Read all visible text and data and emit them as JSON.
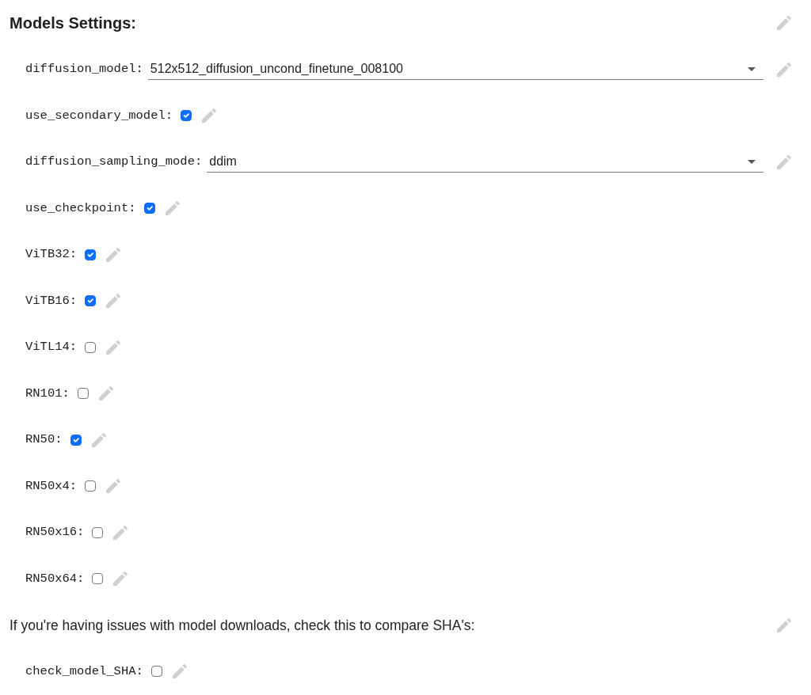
{
  "title": "Models Settings:",
  "fields": [
    {
      "kind": "dropdown",
      "label": "diffusion_model:",
      "value": "512x512_diffusion_uncond_finetune_008100"
    },
    {
      "kind": "checkbox",
      "label": "use_secondary_model:",
      "checked": true
    },
    {
      "kind": "dropdown",
      "label": "diffusion_sampling_mode:",
      "value": "ddim"
    },
    {
      "kind": "checkbox",
      "label": "use_checkpoint:",
      "checked": true
    },
    {
      "kind": "checkbox",
      "label": "ViTB32:",
      "checked": true
    },
    {
      "kind": "checkbox",
      "label": "ViTB16:",
      "checked": true
    },
    {
      "kind": "checkbox",
      "label": "ViTL14:",
      "checked": false
    },
    {
      "kind": "checkbox",
      "label": "RN101:",
      "checked": false
    },
    {
      "kind": "checkbox",
      "label": "RN50:",
      "checked": true
    },
    {
      "kind": "checkbox",
      "label": "RN50x4:",
      "checked": false
    },
    {
      "kind": "checkbox",
      "label": "RN50x16:",
      "checked": false
    },
    {
      "kind": "checkbox",
      "label": "RN50x64:",
      "checked": false
    },
    {
      "kind": "note",
      "text": "If you're having issues with model downloads, check this to compare SHA's:"
    },
    {
      "kind": "checkbox",
      "label": "check_model_SHA:",
      "checked": false
    }
  ]
}
